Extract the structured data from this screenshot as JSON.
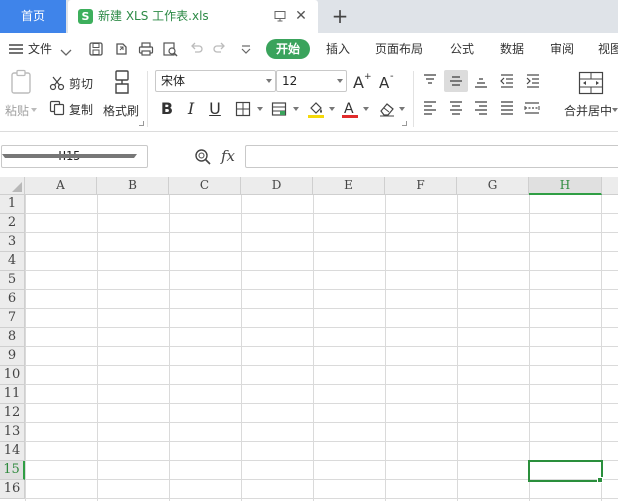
{
  "tabs": {
    "home_label": "首页",
    "doc_logo": "S",
    "doc_title": "新建 XLS 工作表.xls",
    "close_glyph": "✕",
    "add_glyph": "+"
  },
  "menu": {
    "file_label": "文件",
    "items": [
      "开始",
      "插入",
      "页面布局",
      "公式",
      "数据",
      "审阅",
      "视图"
    ]
  },
  "ribbon": {
    "paste_label": "粘贴",
    "cut_label": "剪切",
    "copy_label": "复制",
    "format_painter_label": "格式刷",
    "font_name": "宋体",
    "font_size": "12",
    "bold": "B",
    "italic": "I",
    "underline": "U",
    "merge_label": "合并居中"
  },
  "formula_bar": {
    "cell_ref": "H15",
    "fx_label": "fx",
    "formula": ""
  },
  "sheet": {
    "columns": [
      "A",
      "B",
      "C",
      "D",
      "E",
      "F",
      "G",
      "H"
    ],
    "rows": [
      "1",
      "2",
      "3",
      "4",
      "5",
      "6",
      "7",
      "8",
      "9",
      "10",
      "11",
      "12",
      "13",
      "14",
      "15",
      "16"
    ],
    "active_column": "H",
    "active_row": "15",
    "accent_color": "#2a8f3c"
  },
  "colors": {
    "home_tab": "#3f84ea",
    "start_pill": "#3aa35c",
    "selection": "#2a8f3c"
  }
}
